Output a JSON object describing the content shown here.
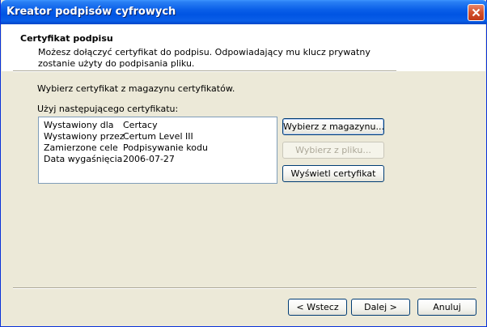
{
  "window": {
    "title": "Kreator podpisów cyfrowych"
  },
  "header": {
    "title": "Certyfikat podpisu",
    "description": "Możesz dołączyć certyfikat do podpisu. Odpowiadający mu klucz prywatny zostanie użyty do podpisania pliku."
  },
  "body": {
    "instruction": "Wybierz certyfikat z magazynu certyfikatów.",
    "certificate_label": "Użyj następującego certyfikatu:",
    "certificate": [
      {
        "key": "Wystawiony dla",
        "value": "Certacy"
      },
      {
        "key": "Wystawiony przez",
        "value": "Certum Level III"
      },
      {
        "key": "Zamierzone cele",
        "value": "Podpisywanie kodu"
      },
      {
        "key": "Data wygaśnięcia",
        "value": "2006-07-27"
      }
    ],
    "buttons": {
      "select_store": "Wybierz z magazynu...",
      "select_file": "Wybierz z pliku...",
      "view_cert": "Wyświetl certyfikat"
    }
  },
  "footer": {
    "back": "< Wstecz",
    "next": "Dalej >",
    "cancel": "Anuluj"
  },
  "colors": {
    "titlebar": "#0054e3",
    "dialog_bg": "#ece9d8",
    "close_button": "#d2502c"
  }
}
